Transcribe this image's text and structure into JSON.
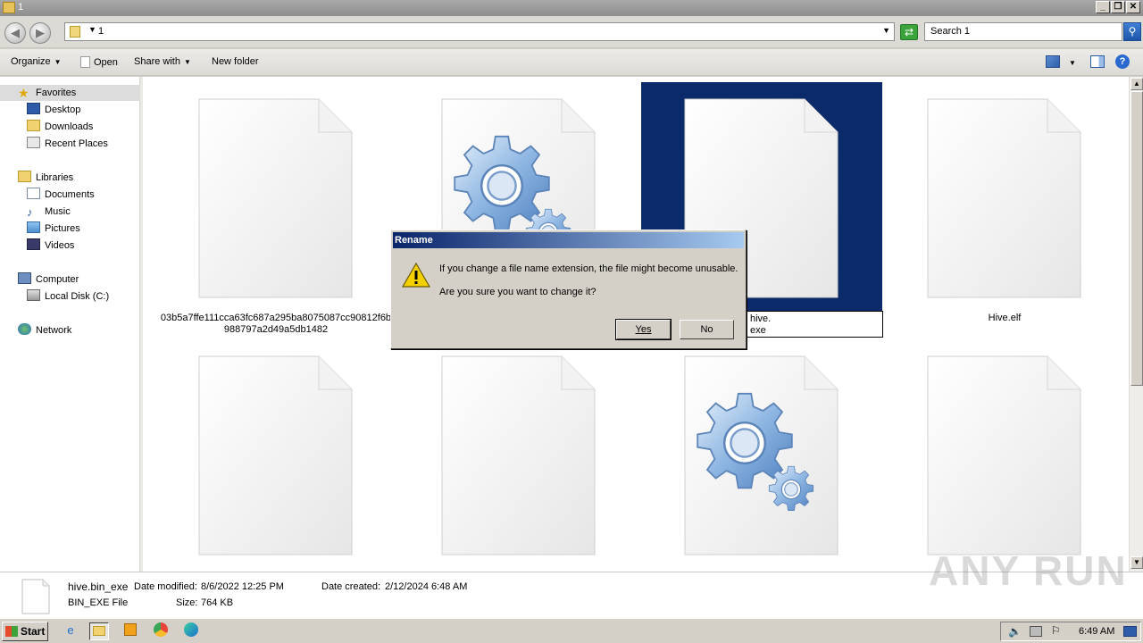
{
  "window": {
    "title": "1"
  },
  "address": {
    "crumb": "1",
    "search_placeholder": "Search 1"
  },
  "toolbar": {
    "organize": "Organize",
    "open": "Open",
    "share_with": "Share with",
    "new_folder": "New folder"
  },
  "nav": {
    "favorites": "Favorites",
    "desktop": "Desktop",
    "downloads": "Downloads",
    "recent": "Recent Places",
    "libraries": "Libraries",
    "documents": "Documents",
    "music": "Music",
    "pictures": "Pictures",
    "videos": "Videos",
    "computer": "Computer",
    "local_disk": "Local Disk (C:)",
    "network": "Network"
  },
  "files": [
    {
      "name_line1": "03b5a7ffe111cca63fc687a295ba8075087cc90812f6b",
      "name_line2": "988797a2d49a5db1482",
      "icon": "blank-file-icon"
    },
    {
      "name_line1": "",
      "name_line2": "",
      "icon": "exe-gear-icon"
    },
    {
      "rename_line1": "hive.",
      "rename_line2": "exe",
      "icon": "blank-file-icon",
      "selected": true
    },
    {
      "name_line1": "Hive.elf",
      "icon": "blank-file-icon"
    },
    {
      "icon": "blank-file-icon"
    },
    {
      "icon": "blank-file-icon"
    },
    {
      "icon": "exe-gear-icon"
    },
    {
      "icon": "blank-file-icon"
    }
  ],
  "details": {
    "file_name": "hive.bin_exe",
    "file_type": "BIN_EXE File",
    "date_modified_label": "Date modified:",
    "date_modified": "8/6/2022 12:25 PM",
    "date_created_label": "Date created:",
    "date_created": "2/12/2024 6:48 AM",
    "size_label": "Size:",
    "size": "764 KB"
  },
  "dialog": {
    "title": "Rename",
    "message": "If you change a file name extension, the file might become unusable.",
    "question": "Are you sure you want to change it?",
    "yes": "Yes",
    "no": "No"
  },
  "taskbar": {
    "start": "Start",
    "clock": "6:49 AM"
  },
  "watermark": "ANY RUN"
}
